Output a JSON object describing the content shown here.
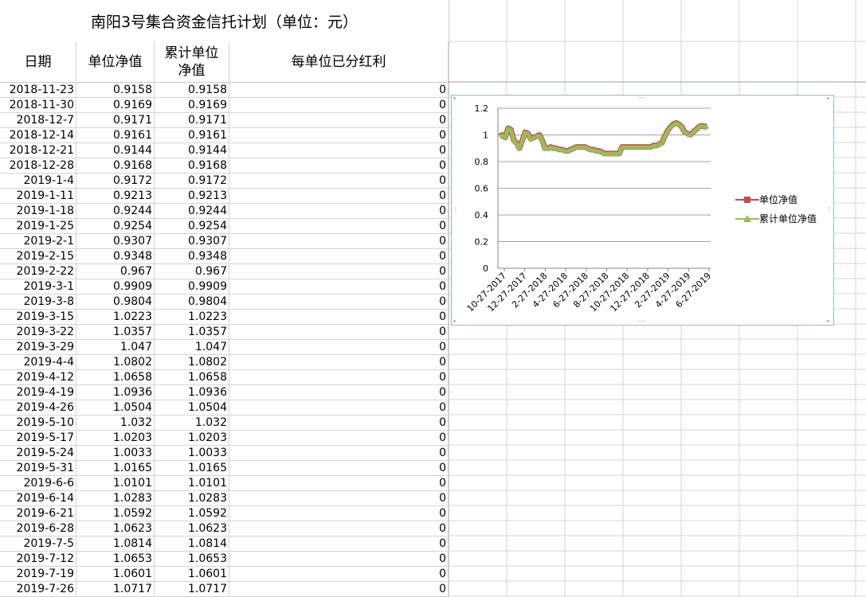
{
  "sheet": {
    "title": "南阳3号集合资金信托计划（单位：元）",
    "headers": [
      "日期",
      "单位净值",
      "累计单位净值",
      "每单位已分红利"
    ],
    "rows": [
      [
        "2018-11-23",
        "0.9158",
        "0.9158",
        "0"
      ],
      [
        "2018-11-30",
        "0.9169",
        "0.9169",
        "0"
      ],
      [
        "2018-12-7",
        "0.9171",
        "0.9171",
        "0"
      ],
      [
        "2018-12-14",
        "0.9161",
        "0.9161",
        "0"
      ],
      [
        "2018-12-21",
        "0.9144",
        "0.9144",
        "0"
      ],
      [
        "2018-12-28",
        "0.9168",
        "0.9168",
        "0"
      ],
      [
        "2019-1-4",
        "0.9172",
        "0.9172",
        "0"
      ],
      [
        "2019-1-11",
        "0.9213",
        "0.9213",
        "0"
      ],
      [
        "2019-1-18",
        "0.9244",
        "0.9244",
        "0"
      ],
      [
        "2019-1-25",
        "0.9254",
        "0.9254",
        "0"
      ],
      [
        "2019-2-1",
        "0.9307",
        "0.9307",
        "0"
      ],
      [
        "2019-2-15",
        "0.9348",
        "0.9348",
        "0"
      ],
      [
        "2019-2-22",
        "0.967",
        "0.967",
        "0"
      ],
      [
        "2019-3-1",
        "0.9909",
        "0.9909",
        "0"
      ],
      [
        "2019-3-8",
        "0.9804",
        "0.9804",
        "0"
      ],
      [
        "2019-3-15",
        "1.0223",
        "1.0223",
        "0"
      ],
      [
        "2019-3-22",
        "1.0357",
        "1.0357",
        "0"
      ],
      [
        "2019-3-29",
        "1.047",
        "1.047",
        "0"
      ],
      [
        "2019-4-4",
        "1.0802",
        "1.0802",
        "0"
      ],
      [
        "2019-4-12",
        "1.0658",
        "1.0658",
        "0"
      ],
      [
        "2019-4-19",
        "1.0936",
        "1.0936",
        "0"
      ],
      [
        "2019-4-26",
        "1.0504",
        "1.0504",
        "0"
      ],
      [
        "2019-5-10",
        "1.032",
        "1.032",
        "0"
      ],
      [
        "2019-5-17",
        "1.0203",
        "1.0203",
        "0"
      ],
      [
        "2019-5-24",
        "1.0033",
        "1.0033",
        "0"
      ],
      [
        "2019-5-31",
        "1.0165",
        "1.0165",
        "0"
      ],
      [
        "2019-6-6",
        "1.0101",
        "1.0101",
        "0"
      ],
      [
        "2019-6-14",
        "1.0283",
        "1.0283",
        "0"
      ],
      [
        "2019-6-21",
        "1.0592",
        "1.0592",
        "0"
      ],
      [
        "2019-6-28",
        "1.0623",
        "1.0623",
        "0"
      ],
      [
        "2019-7-5",
        "1.0814",
        "1.0814",
        "0"
      ],
      [
        "2019-7-12",
        "1.0653",
        "1.0653",
        "0"
      ],
      [
        "2019-7-19",
        "1.0601",
        "1.0601",
        "0"
      ],
      [
        "2019-7-26",
        "1.0717",
        "1.0717",
        "0"
      ]
    ]
  },
  "chart_data": {
    "type": "line",
    "x_tick_labels": [
      "10-27-2017",
      "12-27-2017",
      "2-27-2018",
      "4-27-2018",
      "6-27-2018",
      "8-27-2018",
      "10-27-2018",
      "12-27-2018",
      "2-27-2019",
      "4-27-2019",
      "6-27-2019"
    ],
    "y_tick_labels": [
      "0",
      "0.2",
      "0.4",
      "0.6",
      "0.8",
      "1",
      "1.2"
    ],
    "ylim": [
      0,
      1.2
    ],
    "grid": true,
    "legend_position": "right",
    "series": [
      {
        "name": "单位净值",
        "color": "#c0504d",
        "values": [
          0.99,
          1.0,
          0.98,
          1.05,
          1.04,
          0.96,
          0.94,
          0.9,
          0.96,
          1.02,
          1.01,
          0.97,
          0.98,
          0.99,
          1.0,
          0.96,
          0.9,
          0.9,
          0.91,
          0.9,
          0.9,
          0.89,
          0.89,
          0.88,
          0.88,
          0.89,
          0.9,
          0.91,
          0.91,
          0.91,
          0.91,
          0.9,
          0.89,
          0.89,
          0.88,
          0.88,
          0.87,
          0.86,
          0.86,
          0.86,
          0.86,
          0.86,
          0.86,
          0.91,
          0.91,
          0.91,
          0.91,
          0.91,
          0.91,
          0.91,
          0.91,
          0.91,
          0.91,
          0.91,
          0.92,
          0.92,
          0.93,
          0.94,
          0.99,
          1.03,
          1.06,
          1.08,
          1.09,
          1.08,
          1.06,
          1.02,
          1.01,
          1.0,
          1.02,
          1.04,
          1.06,
          1.07,
          1.06,
          1.07
        ]
      },
      {
        "name": "累计单位净值",
        "color": "#9bbb59",
        "values": [
          0.99,
          1.0,
          0.98,
          1.05,
          1.04,
          0.96,
          0.94,
          0.9,
          0.96,
          1.02,
          1.01,
          0.97,
          0.98,
          0.99,
          1.0,
          0.96,
          0.9,
          0.9,
          0.91,
          0.9,
          0.9,
          0.89,
          0.89,
          0.88,
          0.88,
          0.89,
          0.9,
          0.91,
          0.91,
          0.91,
          0.91,
          0.9,
          0.89,
          0.89,
          0.88,
          0.88,
          0.87,
          0.86,
          0.86,
          0.86,
          0.86,
          0.86,
          0.86,
          0.91,
          0.91,
          0.91,
          0.91,
          0.91,
          0.91,
          0.91,
          0.91,
          0.91,
          0.91,
          0.91,
          0.92,
          0.92,
          0.93,
          0.94,
          0.99,
          1.03,
          1.06,
          1.08,
          1.09,
          1.08,
          1.06,
          1.02,
          1.01,
          1.0,
          1.02,
          1.04,
          1.06,
          1.07,
          1.06,
          1.07
        ]
      }
    ]
  }
}
